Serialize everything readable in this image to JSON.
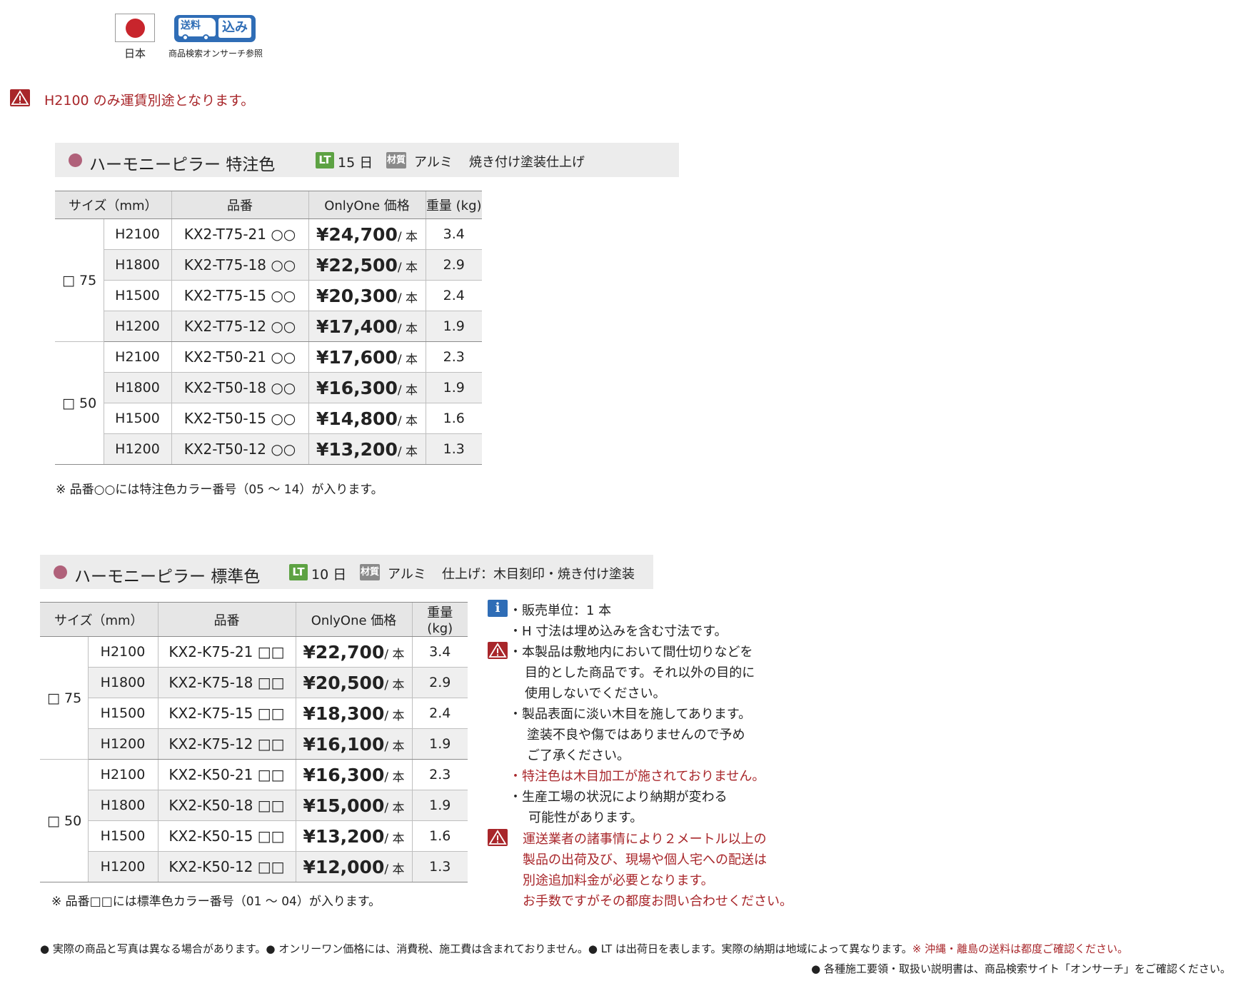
{
  "badges": {
    "origin_label": "日本",
    "shipping_icon_text1": "送料",
    "shipping_icon_text2": "込み",
    "shipping_label": "商品検索オンサーチ参照"
  },
  "top_notice": "H2100 のみ運賃別途となります。",
  "section1": {
    "title": "ハーモニーピラー 特注色",
    "lt_badge": "LT",
    "lt_days": "15 日",
    "material_badge": "材質",
    "material": "アルミ",
    "finish": "焼き付け塗装仕上げ",
    "headers": [
      "サイズ（mm）",
      "品番",
      "OnlyOne 価格",
      "重量 (kg)"
    ],
    "groups": [
      {
        "size": "□ 75",
        "rows": [
          {
            "h": "H2100",
            "code": "KX2-T75-21 ○○",
            "price": "¥24,700",
            "unit": "/ 本",
            "weight": "3.4"
          },
          {
            "h": "H1800",
            "code": "KX2-T75-18 ○○",
            "price": "¥22,500",
            "unit": "/ 本",
            "weight": "2.9"
          },
          {
            "h": "H1500",
            "code": "KX2-T75-15 ○○",
            "price": "¥20,300",
            "unit": "/ 本",
            "weight": "2.4"
          },
          {
            "h": "H1200",
            "code": "KX2-T75-12 ○○",
            "price": "¥17,400",
            "unit": "/ 本",
            "weight": "1.9"
          }
        ]
      },
      {
        "size": "□ 50",
        "rows": [
          {
            "h": "H2100",
            "code": "KX2-T50-21 ○○",
            "price": "¥17,600",
            "unit": "/ 本",
            "weight": "2.3"
          },
          {
            "h": "H1800",
            "code": "KX2-T50-18 ○○",
            "price": "¥16,300",
            "unit": "/ 本",
            "weight": "1.9"
          },
          {
            "h": "H1500",
            "code": "KX2-T50-15 ○○",
            "price": "¥14,800",
            "unit": "/ 本",
            "weight": "1.6"
          },
          {
            "h": "H1200",
            "code": "KX2-T50-12 ○○",
            "price": "¥13,200",
            "unit": "/ 本",
            "weight": "1.3"
          }
        ]
      }
    ],
    "note": "※ 品番○○には特注色カラー番号（05 ～ 14）が入ります。"
  },
  "section2": {
    "title": "ハーモニーピラー 標準色",
    "lt_badge": "LT",
    "lt_days": "10 日",
    "material_badge": "材質",
    "material": "アルミ",
    "finish": "仕上げ：木目刻印・焼き付け塗装",
    "headers": [
      "サイズ（mm）",
      "品番",
      "OnlyOne 価格",
      "重量 (kg)"
    ],
    "groups": [
      {
        "size": "□ 75",
        "rows": [
          {
            "h": "H2100",
            "code": "KX2-K75-21 □□",
            "price": "¥22,700",
            "unit": "/ 本",
            "weight": "3.4"
          },
          {
            "h": "H1800",
            "code": "KX2-K75-18 □□",
            "price": "¥20,500",
            "unit": "/ 本",
            "weight": "2.9"
          },
          {
            "h": "H1500",
            "code": "KX2-K75-15 □□",
            "price": "¥18,300",
            "unit": "/ 本",
            "weight": "2.4"
          },
          {
            "h": "H1200",
            "code": "KX2-K75-12 □□",
            "price": "¥16,100",
            "unit": "/ 本",
            "weight": "1.9"
          }
        ]
      },
      {
        "size": "□ 50",
        "rows": [
          {
            "h": "H2100",
            "code": "KX2-K50-21 □□",
            "price": "¥16,300",
            "unit": "/ 本",
            "weight": "2.3"
          },
          {
            "h": "H1800",
            "code": "KX2-K50-18 □□",
            "price": "¥15,000",
            "unit": "/ 本",
            "weight": "1.9"
          },
          {
            "h": "H1500",
            "code": "KX2-K50-15 □□",
            "price": "¥13,200",
            "unit": "/ 本",
            "weight": "1.6"
          },
          {
            "h": "H1200",
            "code": "KX2-K50-12 □□",
            "price": "¥12,000",
            "unit": "/ 本",
            "weight": "1.3"
          }
        ]
      }
    ],
    "note": "※ 品番□□には標準色カラー番号（01 ～ 04）が入ります。"
  },
  "notes": {
    "info_badge": "i",
    "lines": [
      "・販売単位：1 本",
      "・H 寸法は埋め込みを含む寸法です。",
      "・本製品は敷地内において間仕切りなどを",
      "目的とした商品です。それ以外の目的に",
      "使用しないでください。",
      "・製品表面に淡い木目を施してあります。",
      "塗装不良や傷ではありませんので予め",
      "ご了承ください。",
      "・特注色は木目加工が施されておりません。",
      "・生産工場の状況により納期が変わる",
      "可能性があります。",
      "運送業者の諸事情により２メートル以上の",
      "製品の出荷及び、現場や個人宅への配送は",
      "別途追加料金が必要となります。",
      "お手数ですがその都度お問い合わせください。"
    ]
  },
  "footer": {
    "line1_black": "● 実際の商品と写真は異なる場合があります。● オンリーワン価格には、消費税、施工費は含まれておりません。● LT は出荷日を表します。実際の納期は地域によって異なります。",
    "line1_red": "※ 沖縄・離島の送料は都度ご確認ください。",
    "line2": "● 各種施工要領・取扱い説明書は、商品検索サイト「オンサーチ」をご確認ください。"
  },
  "colors": {
    "accent_red": "#a8262a",
    "info_blue": "#2f6db6",
    "lt_green": "#5da243",
    "title_dot": "#b0617a"
  }
}
